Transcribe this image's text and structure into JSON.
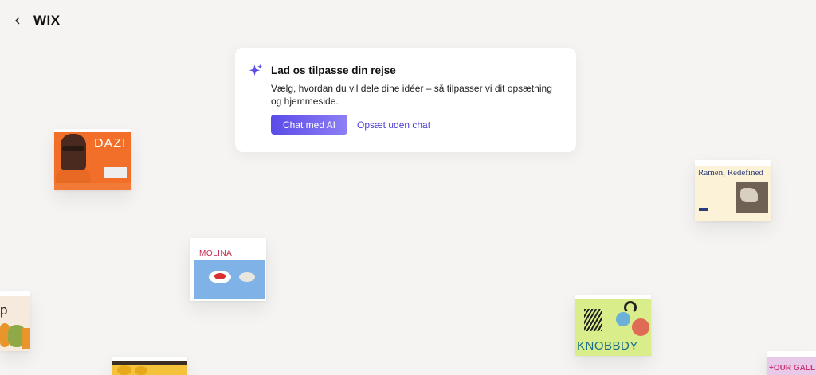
{
  "header": {
    "back_icon": "chevron-left-icon",
    "logo": "WIX"
  },
  "dialog": {
    "icon": "sparkle-icon",
    "accent": "#5b4be8",
    "title": "Lad os tilpasse din rejse",
    "description": "Vælg, hvordan du vil dele dine idéer – så tilpasser vi dit opsætning og hjemmeside.",
    "primary_button": "Chat med AI",
    "secondary_link": "Opsæt uden chat"
  },
  "templates": {
    "dazi": {
      "wordmark": "DAZI"
    },
    "molina": {
      "wordmark": "MOLINA"
    },
    "ramen": {
      "headline": "Ramen, Redefined"
    },
    "shop": {
      "wordmark": "p"
    },
    "knobbdy": {
      "wordmark": "KNOBBDY"
    },
    "gallery": {
      "wordmark": "+OUR GALL"
    }
  }
}
